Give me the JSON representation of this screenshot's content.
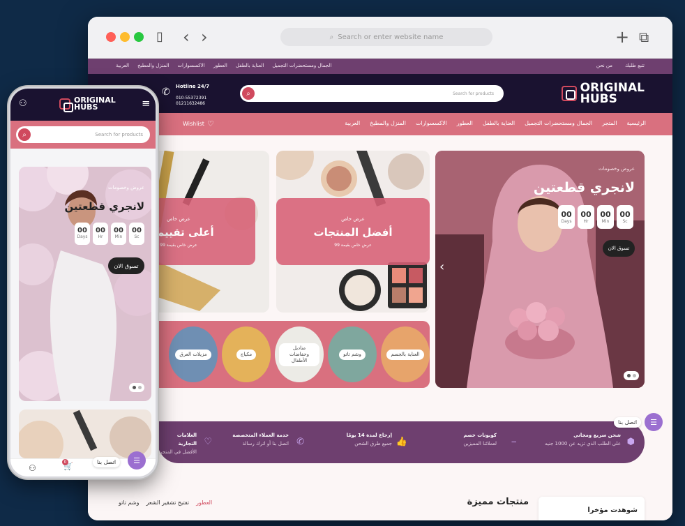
{
  "browser": {
    "url_placeholder": "Search or enter website name",
    "plus_icon": "+",
    "copy_icon": "⧉",
    "back_icon": "‹",
    "forward_icon": "›",
    "sidebar_icon": "▯",
    "search_icon": "⌕"
  },
  "brand": {
    "line1": "ORIGINAL",
    "line2": "HUBS"
  },
  "topbar": {
    "menu": [
      "الجمال ومستحضرات التجميل",
      "العناية بالطفل",
      "العطور",
      "الاكسسوارات",
      "المنزل والمطبخ",
      "العربية"
    ],
    "util": [
      "من نحن",
      "تتبع طلبك"
    ]
  },
  "header": {
    "search_placeholder": "Search for products",
    "hotline_title": "Hotline 24/7",
    "phone1": "010-55372391",
    "phone2": "01211632486",
    "phone_icon": "✆"
  },
  "nav": {
    "items": [
      "الرئيسية",
      "المتجر",
      "الجمال ومستحضرات التجميل",
      "العناية بالطفل",
      "العطور",
      "الاكسسوارات",
      "المنزل والمطبخ",
      "العربية"
    ],
    "wishlist": "Wishlist",
    "heart_icon": "♡"
  },
  "hero": {
    "subtitle": "عروض وخصومات",
    "title": "لانجري قطعتين",
    "countdown": [
      {
        "n": "00",
        "l": "Days"
      },
      {
        "n": "00",
        "l": "Hr"
      },
      {
        "n": "00",
        "l": "Min"
      },
      {
        "n": "00",
        "l": "Sc"
      }
    ],
    "cta": "تسوق الان",
    "prev_icon": "‹"
  },
  "promo1": {
    "kicker": "عرض خاص",
    "title": "أفضل المنتجات",
    "note": "عرض خاص بقيمة 99"
  },
  "promo2": {
    "kicker": "عرض خاص",
    "title": "أعلى تقييمات",
    "note": "عرض خاص بقيمة 99"
  },
  "categories": [
    "العناية بالجسم",
    "وشم تاتو",
    "مناديل وحفاضات الأطفال",
    "مكياج",
    "مزيلات العرق"
  ],
  "features": [
    {
      "title": "شحن سريع ومجاني",
      "sub": "على الطلب الذي تزيد عن 1000 جنيه",
      "icon": "⬢"
    },
    {
      "title": "كوبونات خصم",
      "sub": "لعملائنا المميزين",
      "icon": "⎯"
    },
    {
      "title": "إرجاع لمدة 14 يومًا",
      "sub": "جميع طرق الشحن",
      "icon": "👍"
    },
    {
      "title": "خدمة العملاء المتخصصة",
      "sub": "اتصل بنا أو اترك رسالة",
      "icon": "✆"
    },
    {
      "title": "العلامات التجارية",
      "sub": "الأفضل في المتجر",
      "icon": "♡"
    }
  ],
  "sections": {
    "recent": "شوهدت مؤخرا",
    "featured": "منتجات مميزة",
    "tabs": [
      "العطور",
      "تفتيح تشقير الشعر",
      "وشم تاتو"
    ]
  },
  "contact": {
    "label": "اتصل بنا",
    "chat_icon": "☰"
  },
  "mobile": {
    "search_placeholder": "Search for products",
    "subtitle": "عروض وخصومات",
    "title": "لانجري قطعتين",
    "cta": "تسوق الان",
    "user_icon": "⚇",
    "menu_icon": "≡",
    "cart_icon": "🛒",
    "cart_badge": "0"
  }
}
